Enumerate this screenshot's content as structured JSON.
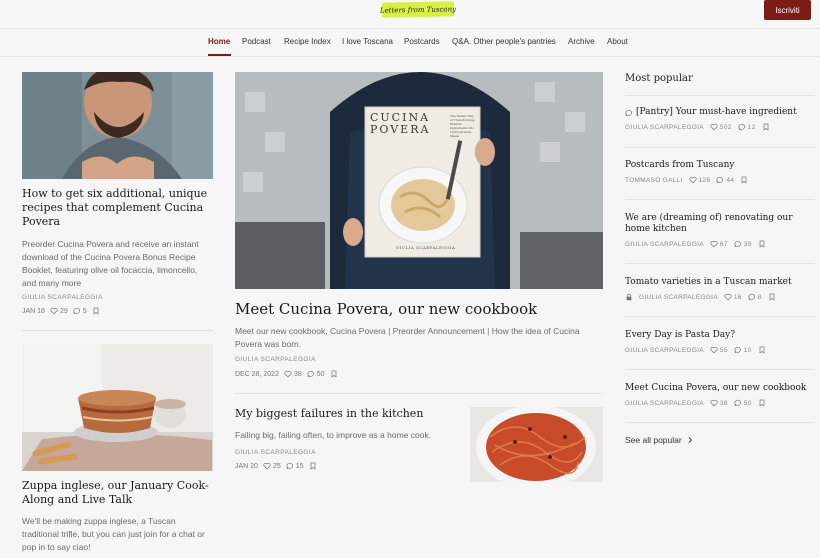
{
  "header": {
    "logo_text": "Letters from Tuscany",
    "subscribe_label": "Iscriviti"
  },
  "nav": {
    "items": [
      "Home",
      "Podcast",
      "Recipe Index",
      "I love Toscana",
      "Postcards",
      "Q&A. Other people's pantries",
      "Archive",
      "About"
    ],
    "active": "Home"
  },
  "posts": {
    "left1": {
      "title": "How to get six additional, unique recipes that complement Cucina Povera",
      "description": "Preorder Cucina Povera and receive an instant download of the Cucina Povera Bonus Recipe Booklet, featuring olive oil focaccia, limoncello, and many more",
      "author": "GIULIA SCARPALEGGIA",
      "date": "JAN 18",
      "likes": "29",
      "comments": "5"
    },
    "left2": {
      "title": "Zuppa inglese, our January Cook-Along and Live Talk",
      "description": "We'll be making zuppa inglese, a Tuscan traditional trifle, but you can just join for a chat or pop in to say ciao!"
    },
    "featured": {
      "title": "Meet Cucina Povera, our new cookbook",
      "description": "Meet our new cookbook, Cucina Povera | Preorder Announcement | How the idea of Cucina Povera was born.",
      "author": "GIULIA SCARPALEGGIA",
      "date": "DEC 28, 2022",
      "likes": "38",
      "comments": "50",
      "book_title_line1": "CUCINA",
      "book_title_line2": "POVERA",
      "book_tagline": "The Italian Way of Transforming Humble Ingredients into Unforgettable Meals",
      "book_author": "GIULIA SCARPALEGGIA"
    },
    "center2": {
      "title": "My biggest failures in the kitchen",
      "description": "Failing big, failing often, to improve as a home cook.",
      "author": "GIULIA SCARPALEGGIA",
      "date": "JAN 20",
      "likes": "25",
      "comments": "15"
    }
  },
  "sidebar": {
    "heading": "Most popular",
    "items": [
      {
        "title": "[Pantry] Your must-have ingredient",
        "author": "GIULIA SCARPALEGGIA",
        "likes": "502",
        "comments": "12",
        "icon": "speech-bubble-icon"
      },
      {
        "title": "Postcards from Tuscany",
        "author": "TOMMASO GALLI",
        "likes": "126",
        "comments": "44"
      },
      {
        "title": "We are (dreaming of) renovating our home kitchen",
        "author": "GIULIA SCARPALEGGIA",
        "likes": "67",
        "comments": "39"
      },
      {
        "title": "Tomato varieties in a Tuscan market",
        "author": "GIULIA SCARPALEGGIA",
        "likes": "16",
        "comments": "8",
        "icon": "lock-icon"
      },
      {
        "title": "Every Day is Pasta Day?",
        "author": "GIULIA SCARPALEGGIA",
        "likes": "55",
        "comments": "10"
      },
      {
        "title": "Meet Cucina Povera, our new cookbook",
        "author": "GIULIA SCARPALEGGIA",
        "likes": "38",
        "comments": "50"
      }
    ],
    "see_all": "See all popular"
  },
  "colors": {
    "accent": "#7c1c17",
    "logo_bg": "#d8f046",
    "background": "#f6f6f6"
  }
}
